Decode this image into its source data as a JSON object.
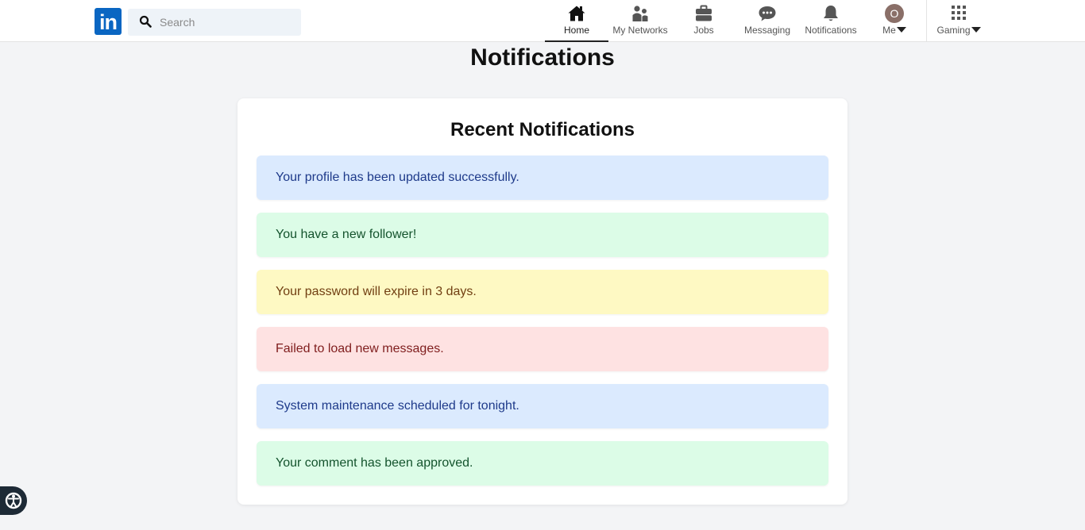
{
  "header": {
    "logo_text": "in",
    "search_placeholder": "Search",
    "nav": [
      {
        "label": "Home",
        "icon": "home-icon"
      },
      {
        "label": "My Networks",
        "icon": "people-icon"
      },
      {
        "label": "Jobs",
        "icon": "briefcase-icon"
      },
      {
        "label": "Messaging",
        "icon": "chat-icon"
      },
      {
        "label": "Notifications",
        "icon": "bell-icon"
      },
      {
        "label": "Me",
        "avatar_initial": "O",
        "icon": "avatar"
      },
      {
        "label": "Gaming",
        "icon": "grid-icon"
      }
    ]
  },
  "page": {
    "title": "Notifications"
  },
  "card": {
    "title": "Recent Notifications",
    "notifications": [
      {
        "text": "Your profile has been updated successfully.",
        "type": "info"
      },
      {
        "text": "You have a new follower!",
        "type": "success"
      },
      {
        "text": "Your password will expire in 3 days.",
        "type": "warning"
      },
      {
        "text": "Failed to load new messages.",
        "type": "error"
      },
      {
        "text": "System maintenance scheduled for tonight.",
        "type": "info"
      },
      {
        "text": "Your comment has been approved.",
        "type": "success"
      }
    ]
  },
  "colors": {
    "brand": "#0a66c2",
    "info_bg": "#dbeafe",
    "success_bg": "#dcfce7",
    "warning_bg": "#fef9c3",
    "error_bg": "#fee2e2"
  }
}
